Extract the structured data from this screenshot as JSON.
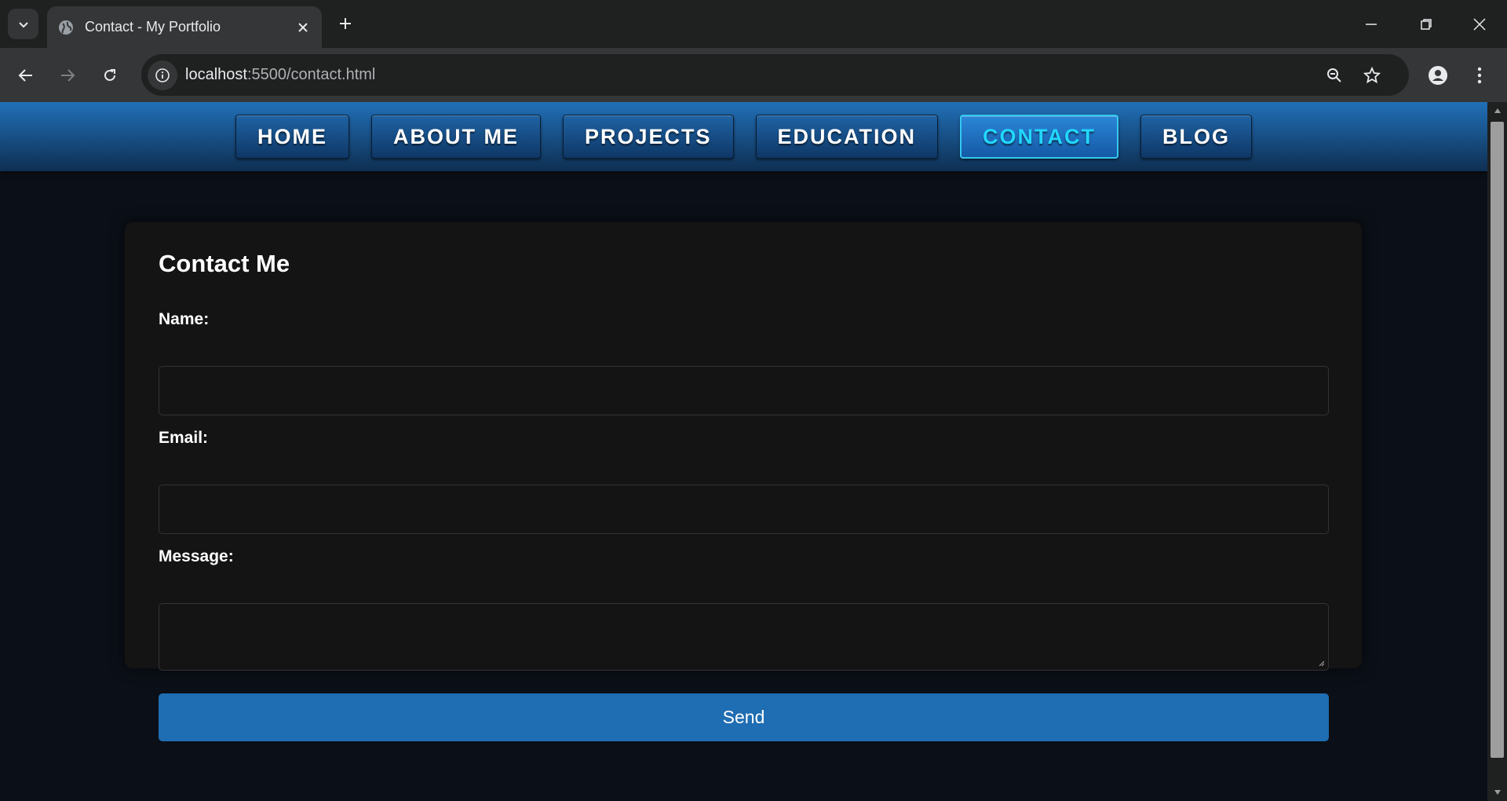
{
  "browser": {
    "tab_title": "Contact - My Portfolio",
    "url_host": "localhost",
    "url_path": ":5500/contact.html",
    "icons": [
      "tab-search-icon",
      "globe-icon",
      "close-icon",
      "plus-icon",
      "minimize-icon",
      "restore-icon",
      "window-close-icon",
      "back-icon",
      "forward-icon",
      "reload-icon",
      "info-icon",
      "zoom-icon",
      "star-icon",
      "profile-icon",
      "menu-icon"
    ]
  },
  "nav": {
    "items": [
      {
        "label": "HOME"
      },
      {
        "label": "ABOUT ME"
      },
      {
        "label": "PROJECTS"
      },
      {
        "label": "EDUCATION"
      },
      {
        "label": "CONTACT",
        "active": true
      },
      {
        "label": "BLOG"
      }
    ]
  },
  "form": {
    "title": "Contact Me",
    "name_label": "Name:",
    "name_value": "",
    "email_label": "Email:",
    "email_value": "",
    "message_label": "Message:",
    "message_value": "",
    "submit_label": "Send"
  },
  "colors": {
    "nav_gradient_top": "#2170b8",
    "active_text": "#22d6ff",
    "button": "#1f6db2",
    "page_bg": "#0b0f17",
    "card_bg": "#141414"
  }
}
